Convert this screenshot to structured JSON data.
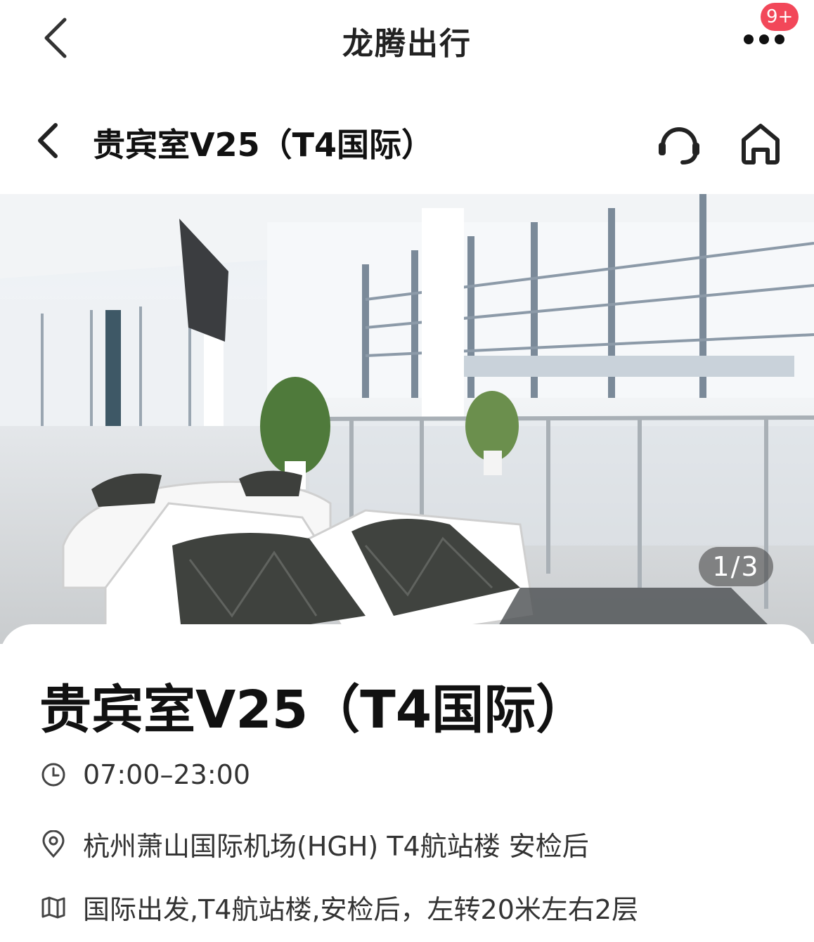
{
  "appbar": {
    "title": "龙腾出行",
    "badge": "9+"
  },
  "subheader": {
    "title": "贵宾室V25（T4国际）"
  },
  "gallery": {
    "counter": "1/3"
  },
  "lounge": {
    "name": "贵宾室V25（T4国际）",
    "hours": "07:00–23:00",
    "address": "杭州萧山国际机场(HGH) T4航站楼 安检后",
    "directions": "国际出发,T4航站楼,安检后，左转20米左右2层"
  },
  "icons": {
    "back": "chevron-left-icon",
    "more": "more-dots-icon",
    "service": "headset-icon",
    "home": "home-icon",
    "clock": "clock-icon",
    "location": "location-pin-icon",
    "map": "map-icon"
  },
  "colors": {
    "badge": "#f24759",
    "text": "#111111"
  }
}
